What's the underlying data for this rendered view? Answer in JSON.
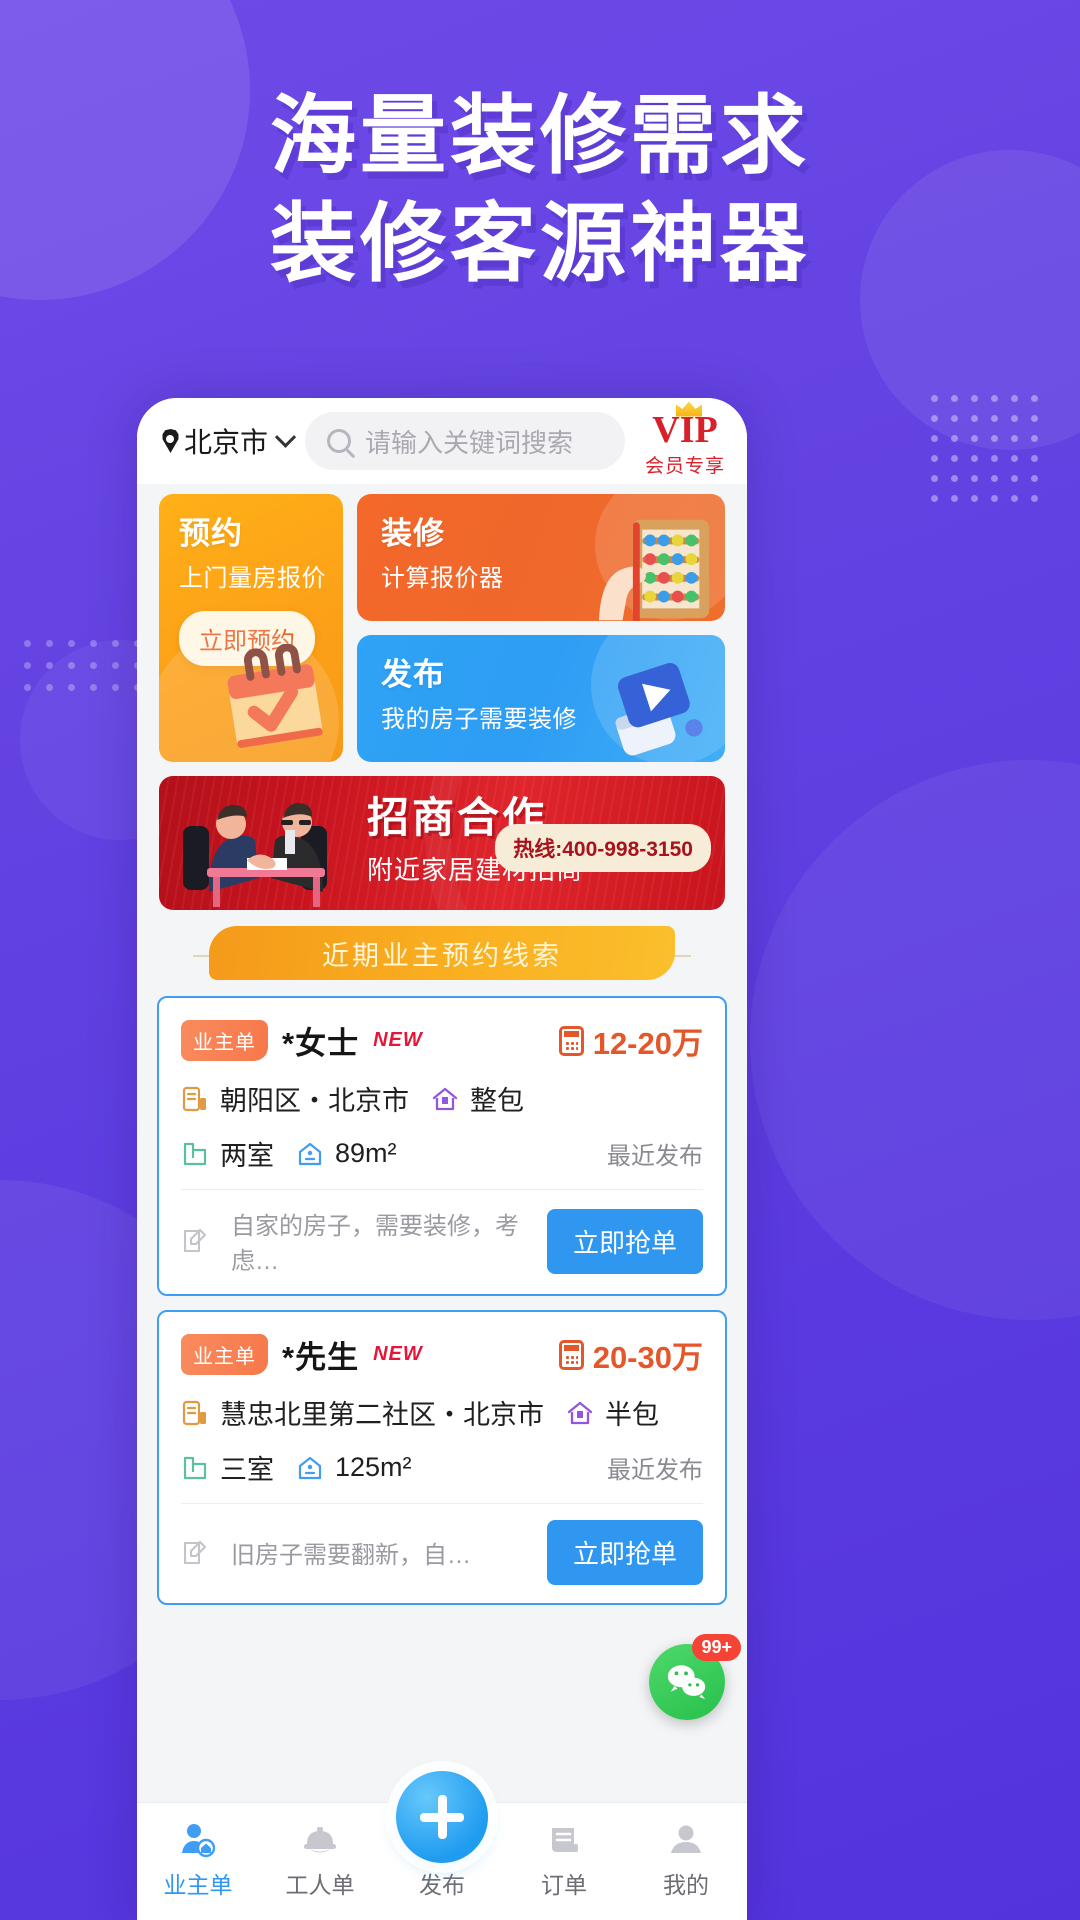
{
  "promo": {
    "headline_line1": "海量装修需求",
    "headline_line2": "装修客源神器"
  },
  "topbar": {
    "city": "北京市",
    "city_chevron_icon": "chevron-down-icon",
    "location_icon": "location-pin-icon",
    "search_icon": "search-icon",
    "search_placeholder": "请输入关键词搜索",
    "search_value": "",
    "vip_title": "VIP",
    "vip_subtitle": "会员专享",
    "vip_crown_icon": "crown-icon"
  },
  "promo_cards": {
    "appointment": {
      "title": "预约",
      "subtitle": "上门量房报价",
      "cta": "立即预约",
      "icon": "calendar-check-icon",
      "bg_color": "#fca018"
    },
    "calculator": {
      "title": "装修",
      "subtitle": "计算报价器",
      "icon": "abacus-icon",
      "bg_color": "#f0672b"
    },
    "publish": {
      "title": "发布",
      "subtitle": "我的房子需要装修",
      "icon": "megaphone-icon",
      "bg_color": "#2e9df4"
    }
  },
  "banner": {
    "title": "招商合作",
    "subtitle": "附近家居建材招商",
    "hotline": "热线:400-998-3150",
    "illustration": "handshake-meeting-icon",
    "bg_color": "#c9141f"
  },
  "section": {
    "ribbon_label": "近期业主预约线索"
  },
  "leads": [
    {
      "tag": "业主单",
      "name": "*女士",
      "new_label": "NEW",
      "price": "12-20万",
      "price_icon": "calculator-icon",
      "location": "朝阳区・北京市",
      "location_icon": "building-icon",
      "package": "整包",
      "package_icon": "house-tag-icon",
      "rooms": "两室",
      "rooms_icon": "floorplan-icon",
      "area": "89m²",
      "area_icon": "house-area-icon",
      "time": "最近发布",
      "desc": "自家的房子，需要装修，考虑…",
      "desc_icon": "note-edit-icon",
      "action": "立即抢单"
    },
    {
      "tag": "业主单",
      "name": "*先生",
      "new_label": "NEW",
      "price": "20-30万",
      "price_icon": "calculator-icon",
      "location": "慧忠北里第二社区・北京市",
      "location_icon": "building-icon",
      "package": "半包",
      "package_icon": "house-tag-icon",
      "rooms": "三室",
      "rooms_icon": "floorplan-icon",
      "area": "125m²",
      "area_icon": "house-area-icon",
      "time": "最近发布",
      "desc": "旧房子需要翻新，自…",
      "desc_icon": "note-edit-icon",
      "action": "立即抢单"
    }
  ],
  "floating": {
    "wechat_icon": "wechat-icon",
    "unread_badge": "99+"
  },
  "tabbar": {
    "items": [
      {
        "label": "业主单",
        "icon": "owner-order-icon",
        "active": true
      },
      {
        "label": "工人单",
        "icon": "worker-helmet-icon",
        "active": false
      },
      {
        "label": "发布",
        "icon": "plus-icon",
        "active": false
      },
      {
        "label": "订单",
        "icon": "receipt-icon",
        "active": false
      },
      {
        "label": "我的",
        "icon": "user-icon",
        "active": false
      }
    ]
  },
  "colors": {
    "brand_purple": "#6342e2",
    "accent_blue": "#2f97f0",
    "accent_orange": "#e4572a",
    "banner_red": "#c9141f"
  }
}
